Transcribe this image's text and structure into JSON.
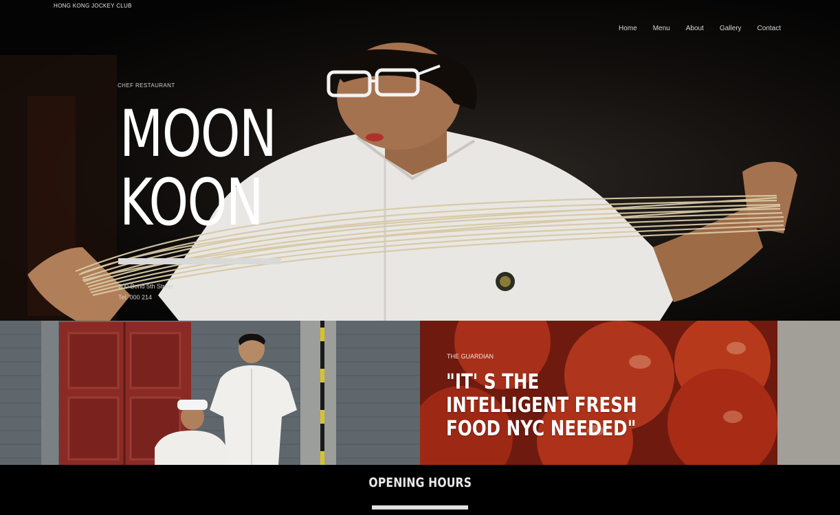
{
  "brand": "HONG KONG JOCKEY CLUB",
  "nav": [
    "Home",
    "Menu",
    "About",
    "Gallery",
    "Contact"
  ],
  "hero": {
    "eyebrow": "CHEF RESTAURANT",
    "title_line1": "MOON",
    "title_line2": "KOON",
    "address": "200 Bond 5th Street",
    "phone": "Tel. 000 214"
  },
  "press": {
    "source": "THE GUARDIAN",
    "quote": "\"IT' S THE INTELLIGENT FRESH FOOD NYC NEEDED\""
  },
  "hours": {
    "title": "OPENING HOURS"
  }
}
